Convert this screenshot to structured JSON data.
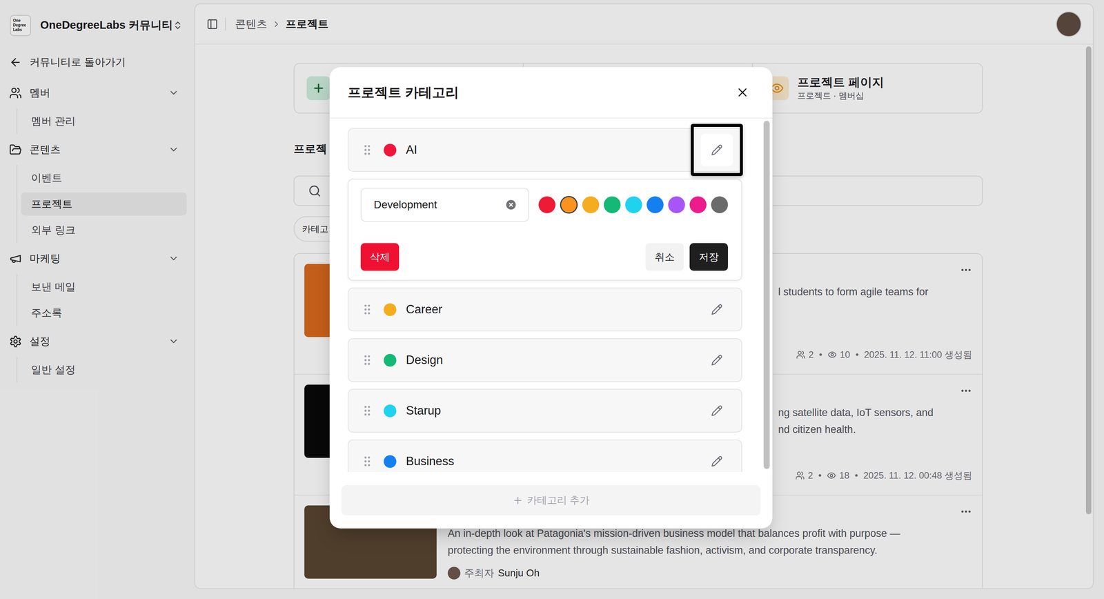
{
  "sidebar": {
    "logo": [
      "One",
      "Degree",
      "Labs"
    ],
    "org": "OneDegreeLabs 커뮤니티",
    "back": "커뮤니티로 돌아가기",
    "groups": [
      {
        "label": "멤버",
        "expanded": true,
        "items": [
          {
            "label": "멤버 관리",
            "selected": false
          }
        ]
      },
      {
        "label": "콘텐츠",
        "expanded": true,
        "items": [
          {
            "label": "이벤트",
            "selected": false
          },
          {
            "label": "프로젝트",
            "selected": true
          },
          {
            "label": "외부 링크",
            "selected": false
          }
        ]
      },
      {
        "label": "마케팅",
        "expanded": true,
        "items": [
          {
            "label": "보낸 메일",
            "selected": false
          },
          {
            "label": "주소록",
            "selected": false
          }
        ]
      },
      {
        "label": "설정",
        "expanded": true,
        "items": [
          {
            "label": "일반 설정",
            "selected": false
          }
        ]
      }
    ]
  },
  "header": {
    "breadcrumb": [
      "콘텐츠",
      "프로젝트"
    ]
  },
  "page": {
    "project_page_card": {
      "title": "프로젝트 페이지",
      "subtitle": "프로젝트 · 멤버십"
    },
    "heading": "프로젝",
    "filter_chip": "카테고",
    "meta_separator": "•",
    "projects": [
      {
        "kind": "covered",
        "description": [
          "l students to form agile teams for"
        ],
        "members": "2",
        "views": "10",
        "created": "2025. 11. 12. 11:00 생성됨"
      },
      {
        "kind": "covered",
        "description": [
          "ng satellite data, IoT sensors, and",
          "nd citizen health."
        ],
        "members": "2",
        "views": "18",
        "created": "2025. 11. 12. 00:48 생성됨"
      },
      {
        "kind": "visible",
        "description": [
          "An in-depth look at Patagonia's mission-driven business model that balances profit with purpose —",
          "protecting the environment through sustainable fashion, activism, and corporate transparency."
        ],
        "host_label": "주최자",
        "host": "Sunju Oh"
      }
    ]
  },
  "modal": {
    "title": "프로젝트 카테고리",
    "categories": [
      {
        "name": "AI",
        "color": "#f0173b",
        "editing": true
      },
      {
        "name": "Career",
        "color": "#f5ac1e",
        "editing": false
      },
      {
        "name": "Design",
        "color": "#14b877",
        "editing": false
      },
      {
        "name": "Starup",
        "color": "#1fd3ee",
        "editing": false
      },
      {
        "name": "Business",
        "color": "#1480f0",
        "editing": false
      }
    ],
    "editor": {
      "value": "Development",
      "colors": [
        {
          "color": "#ef1b36",
          "selected": false
        },
        {
          "color": "#f7931e",
          "selected": true
        },
        {
          "color": "#f5ac1e",
          "selected": false
        },
        {
          "color": "#14b877",
          "selected": false
        },
        {
          "color": "#1fd3ee",
          "selected": false
        },
        {
          "color": "#1480f0",
          "selected": false
        },
        {
          "color": "#a855f7",
          "selected": false
        },
        {
          "color": "#ec1c8c",
          "selected": false
        },
        {
          "color": "#6b6b6b",
          "selected": false
        }
      ],
      "delete": "삭제",
      "cancel": "취소",
      "save": "저장"
    },
    "add_button": {
      "label": "카테고리 추가",
      "disabled": true
    }
  }
}
